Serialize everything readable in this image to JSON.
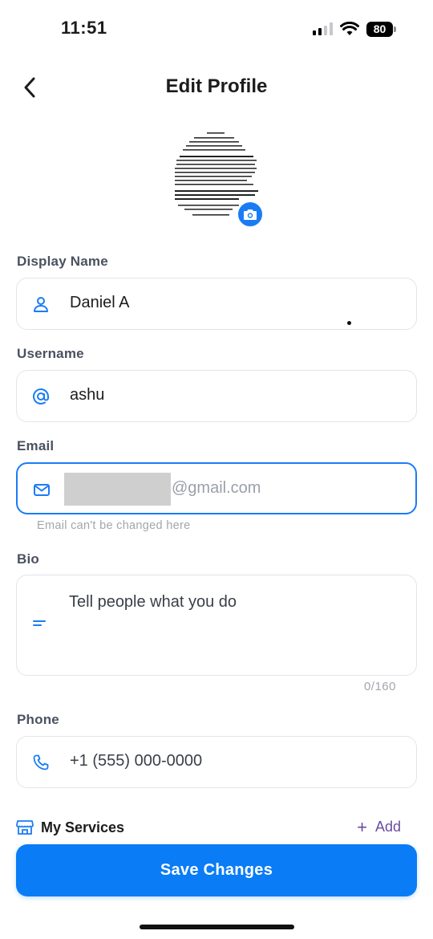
{
  "status_bar": {
    "time": "11:51",
    "battery": "80"
  },
  "header": {
    "title": "Edit Profile"
  },
  "form": {
    "display_name": {
      "label": "Display Name",
      "value": "Daniel A"
    },
    "username": {
      "label": "Username",
      "value": "ashu"
    },
    "email": {
      "label": "Email",
      "value_suffix": "@gmail.com",
      "hint": "Email can't be changed here"
    },
    "bio": {
      "label": "Bio",
      "placeholder": "Tell people what you do",
      "counter": "0/160"
    },
    "phone": {
      "label": "Phone",
      "placeholder": "+1 (555) 000-0000"
    }
  },
  "services": {
    "title": "My Services",
    "add_label": "Add"
  },
  "save_button": {
    "label": "Save Changes"
  },
  "colors": {
    "accent": "#1a7cf5",
    "save_button": "#0a7cf6",
    "add_link": "#6b4ba1",
    "label_text": "#4a5160",
    "border": "#e3e5ea"
  }
}
